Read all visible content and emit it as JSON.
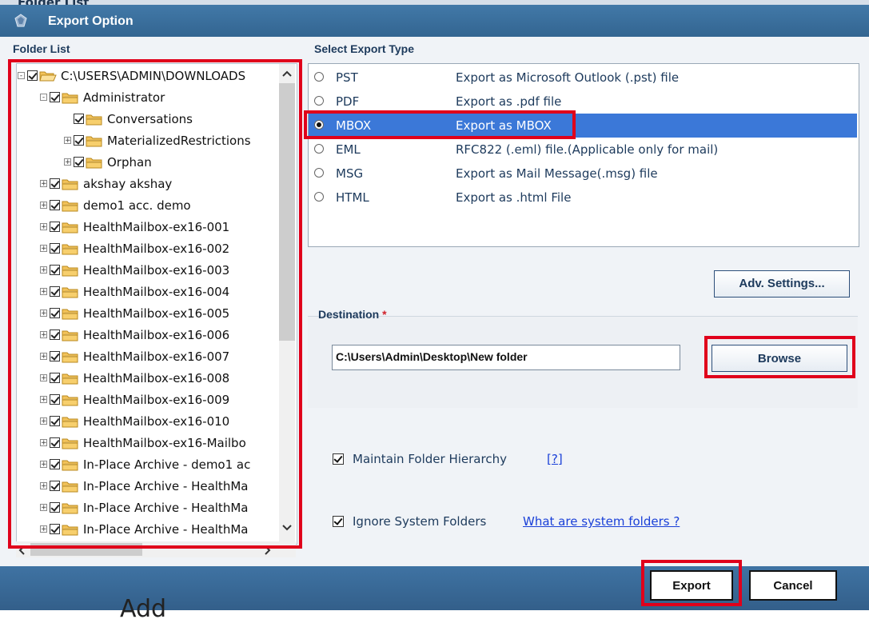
{
  "background": {
    "window_title": "Folder List",
    "bottom_text": "Add"
  },
  "dialog": {
    "title": "Export Option",
    "folder_list_label": "Folder List",
    "select_export_type_label": "Select Export Type",
    "destination_label": "Destination",
    "required_marker": "*"
  },
  "tree": [
    {
      "label": "C:\\USERS\\ADMIN\\DOWNLOADS",
      "expander": "-",
      "open": true,
      "level": 0
    },
    {
      "label": "Administrator",
      "expander": "-",
      "open": false,
      "level": 1
    },
    {
      "label": "Conversations",
      "expander": "",
      "open": false,
      "level": 2
    },
    {
      "label": "MaterializedRestrictions",
      "expander": "+",
      "open": false,
      "level": 2
    },
    {
      "label": "Orphan",
      "expander": "+",
      "open": false,
      "level": 2
    },
    {
      "label": "akshay akshay",
      "expander": "+",
      "open": false,
      "level": 1
    },
    {
      "label": "demo1 acc. demo",
      "expander": "+",
      "open": false,
      "level": 1
    },
    {
      "label": "HealthMailbox-ex16-001",
      "expander": "+",
      "open": false,
      "level": 1
    },
    {
      "label": "HealthMailbox-ex16-002",
      "expander": "+",
      "open": false,
      "level": 1
    },
    {
      "label": "HealthMailbox-ex16-003",
      "expander": "+",
      "open": false,
      "level": 1
    },
    {
      "label": "HealthMailbox-ex16-004",
      "expander": "+",
      "open": false,
      "level": 1
    },
    {
      "label": "HealthMailbox-ex16-005",
      "expander": "+",
      "open": false,
      "level": 1
    },
    {
      "label": "HealthMailbox-ex16-006",
      "expander": "+",
      "open": false,
      "level": 1
    },
    {
      "label": "HealthMailbox-ex16-007",
      "expander": "+",
      "open": false,
      "level": 1
    },
    {
      "label": "HealthMailbox-ex16-008",
      "expander": "+",
      "open": false,
      "level": 1
    },
    {
      "label": "HealthMailbox-ex16-009",
      "expander": "+",
      "open": false,
      "level": 1
    },
    {
      "label": "HealthMailbox-ex16-010",
      "expander": "+",
      "open": false,
      "level": 1
    },
    {
      "label": "HealthMailbox-ex16-Mailbo",
      "expander": "+",
      "open": false,
      "level": 1
    },
    {
      "label": "In-Place Archive - demo1 ac",
      "expander": "+",
      "open": false,
      "level": 1
    },
    {
      "label": "In-Place Archive - HealthMa",
      "expander": "+",
      "open": false,
      "level": 1
    },
    {
      "label": "In-Place Archive - HealthMa",
      "expander": "+",
      "open": false,
      "level": 1
    },
    {
      "label": "In-Place Archive - HealthMa",
      "expander": "+",
      "open": false,
      "level": 1
    }
  ],
  "export_types": [
    {
      "name": "PST",
      "desc": "Export as Microsoft Outlook (.pst) file",
      "selected": false
    },
    {
      "name": "PDF",
      "desc": "Export as .pdf file",
      "selected": false
    },
    {
      "name": "MBOX",
      "desc": "Export as MBOX",
      "selected": true
    },
    {
      "name": "EML",
      "desc": "RFC822 (.eml) file.(Applicable only for mail)",
      "selected": false
    },
    {
      "name": "MSG",
      "desc": "Export as Mail Message(.msg) file",
      "selected": false
    },
    {
      "name": "HTML",
      "desc": "Export as .html File",
      "selected": false
    }
  ],
  "buttons": {
    "adv_settings": "Adv. Settings...",
    "browse": "Browse",
    "export": "Export",
    "cancel": "Cancel"
  },
  "destination": {
    "value": "C:\\Users\\Admin\\Desktop\\New folder"
  },
  "options": {
    "maintain_hierarchy": {
      "label": "Maintain Folder Hierarchy",
      "checked": true,
      "help_link": "[?]"
    },
    "ignore_system": {
      "label": "Ignore System Folders",
      "checked": true,
      "help_link": "What are system folders ?"
    }
  },
  "icons": {
    "app": "app-logo-icon",
    "folder": "folder-icon",
    "folder_open": "folder-open-icon",
    "scroll_up": "scroll-up-arrow-icon",
    "scroll_down": "scroll-down-arrow-icon",
    "scroll_left": "scroll-left-arrow-icon",
    "scroll_right": "scroll-right-arrow-icon"
  },
  "colors": {
    "titlebar": "#3a6f9e",
    "selection": "#3b78d8",
    "highlight_box": "#e0001b",
    "link": "#1a40d8"
  }
}
